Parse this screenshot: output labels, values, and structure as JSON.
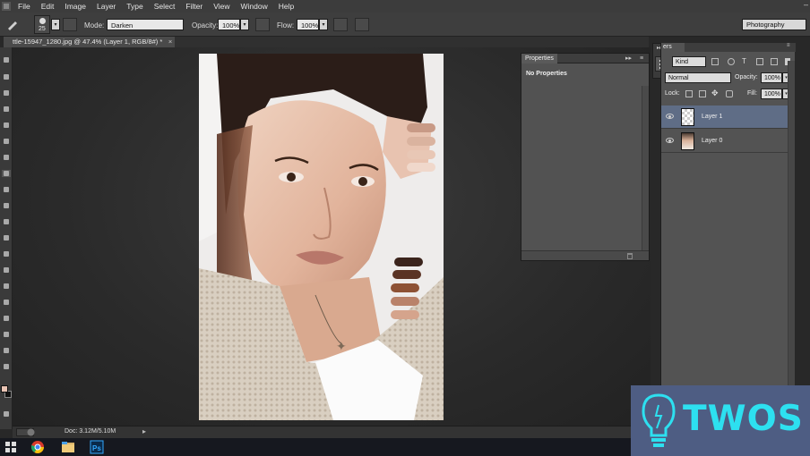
{
  "menubar": {
    "items": [
      "File",
      "Edit",
      "Image",
      "Layer",
      "Type",
      "Select",
      "Filter",
      "View",
      "Window",
      "Help"
    ],
    "minimize": "–"
  },
  "options": {
    "brush_size": "25",
    "mode_label": "Mode:",
    "mode_value": "Darken",
    "opacity_label": "Opacity:",
    "opacity_value": "100%",
    "flow_label": "Flow:",
    "flow_value": "100%",
    "workspace": "Photography"
  },
  "document": {
    "tab_title": "ttle-15947_1280.jpg @ 47.4% (Layer 1, RGB/8#) *",
    "close": "×"
  },
  "status": {
    "doc_size": "Doc: 3.12M/5.10M",
    "arrow": "▸"
  },
  "properties": {
    "tab": "Properties",
    "controls": "▸▸",
    "menu": "≡",
    "message": "No Properties"
  },
  "layers": {
    "tab": "ers",
    "kind": "Kind",
    "blend_mode": "Normal",
    "opacity_label": "Opacity:",
    "opacity_value": "100%",
    "lock_label": "Lock:",
    "fill_label": "Fill:",
    "fill_value": "100%",
    "items": [
      {
        "name": "Layer 1",
        "selected": true,
        "thumb": "transparent"
      },
      {
        "name": "Layer 0",
        "selected": false,
        "thumb": "photo"
      }
    ]
  },
  "watermark": {
    "text": "TWOS"
  },
  "colors": {
    "foreground": "#e9c4b4",
    "background": "#111111",
    "selection": "#5f6d86",
    "watermark_bg": "#4e5d83",
    "watermark_text": "#2de0f0"
  }
}
